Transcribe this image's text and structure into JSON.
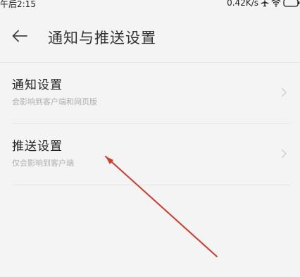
{
  "status_bar": {
    "time": "午后2:15",
    "network_speed": "0.42K/s",
    "icons": [
      "airplane-icon",
      "wifi-icon",
      "battery-icon"
    ]
  },
  "header": {
    "back_icon": "arrow-left-icon",
    "title": "通知与推送设置"
  },
  "settings": {
    "items": [
      {
        "title": "通知设置",
        "subtitle": "会影响到客户端和网页版",
        "icon": "chevron-right-icon"
      },
      {
        "title": "推送设置",
        "subtitle": "仅会影响到客户端",
        "icon": "chevron-right-icon"
      }
    ]
  },
  "colors": {
    "background": "#f4f4f4",
    "title_text": "#222222",
    "subtitle_text": "#b0b0b0",
    "annotation": "#d23a2a"
  }
}
